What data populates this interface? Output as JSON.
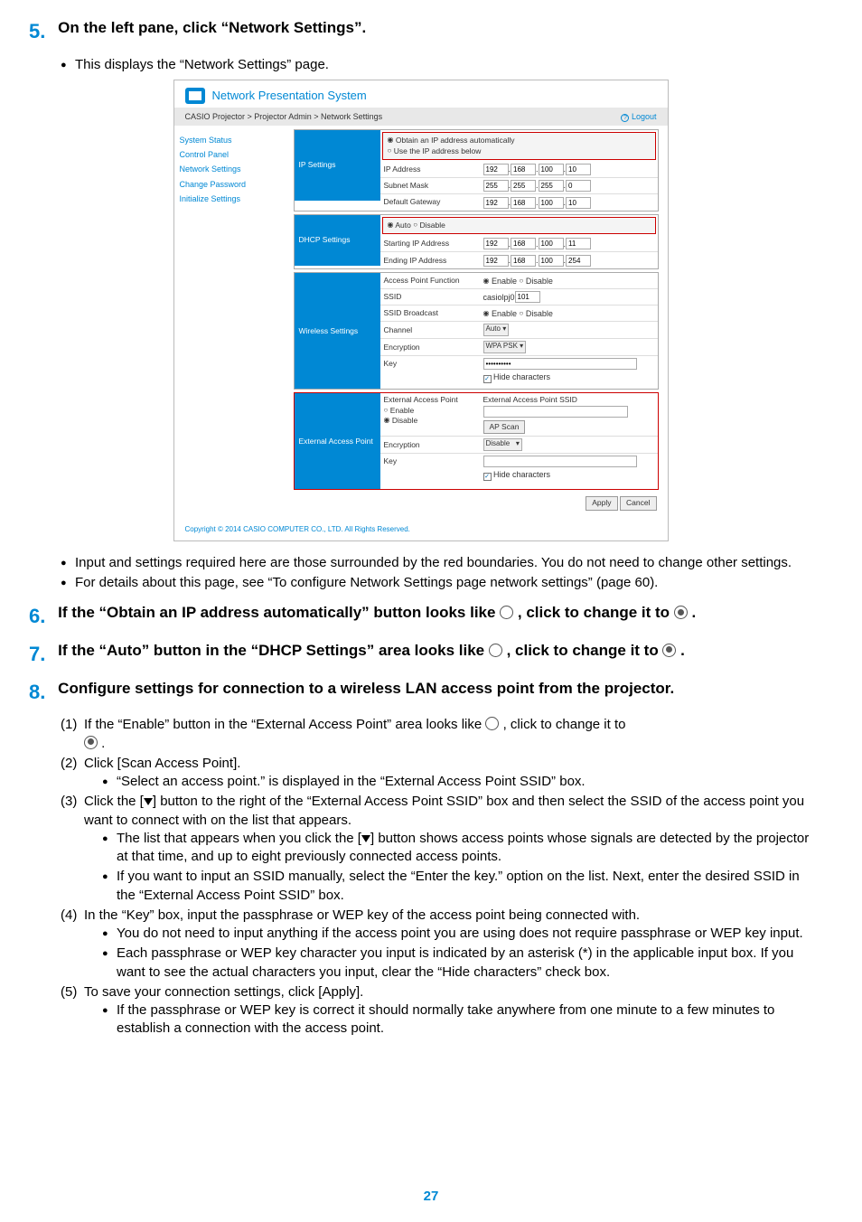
{
  "step5": {
    "num": "5.",
    "heading": "On the left pane, click “Network Settings”.",
    "bullet1": "This displays the “Network Settings” page."
  },
  "screenshot": {
    "window_title": "Network Presentation System",
    "breadcrumb": "CASIO Projector > Projector Admin > Network Settings",
    "logout": "Logout",
    "nav": [
      "System Status",
      "Control Panel",
      "Network Settings",
      "Change Password",
      "Initialize Settings"
    ],
    "ip_settings": {
      "title": "IP Settings",
      "opt_auto": "Obtain an IP address automatically",
      "opt_manual": "Use the IP address below",
      "ip_label": "IP Address",
      "ip": [
        "192",
        "168",
        "100",
        "10"
      ],
      "mask_label": "Subnet Mask",
      "mask": [
        "255",
        "255",
        "255",
        "0"
      ],
      "gw_label": "Default Gateway",
      "gw": [
        "192",
        "168",
        "100",
        "10"
      ]
    },
    "dhcp_settings": {
      "title": "DHCP Settings",
      "auto": "Auto",
      "disable": "Disable",
      "start_label": "Starting IP Address",
      "start": [
        "192",
        "168",
        "100",
        "11"
      ],
      "end_label": "Ending IP Address",
      "end": [
        "192",
        "168",
        "100",
        "254"
      ]
    },
    "wireless": {
      "title": "Wireless Settings",
      "apf_label": "Access Point Function",
      "enable": "Enable",
      "disable": "Disable",
      "ssid_label": "SSID",
      "ssid_prefix": "casiolpj0",
      "ssid_suffix": "101",
      "ssidbr_label": "SSID Broadcast",
      "ch_label": "Channel",
      "ch": "Auto",
      "enc_label": "Encryption",
      "enc": "WPA PSK",
      "key_label": "Key",
      "key": "••••••••••",
      "hide": "Hide characters"
    },
    "ext_ap": {
      "title": "External Access Point",
      "heading": "External Access Point",
      "enable": "Enable",
      "disable": "Disable",
      "ssid_label": "External Access Point SSID",
      "scan_btn": "AP Scan",
      "enc_label": "Encryption",
      "enc": "Disable",
      "key_label": "Key",
      "hide": "Hide characters"
    },
    "apply": "Apply",
    "cancel": "Cancel",
    "copyright": "Copyright © 2014 CASIO COMPUTER CO., LTD. All Rights Reserved."
  },
  "post5": {
    "b1": "Input and settings required here are those surrounded by the red boundaries. You do not need to change other settings.",
    "b2": "For details about this page, see “To configure Network Settings page network settings” (page 60)."
  },
  "step6": {
    "num": "6.",
    "part1": "If the “Obtain an IP address automatically” button looks like ",
    "part2": " , click to change it to ",
    "part3": " ."
  },
  "step7": {
    "num": "7.",
    "part1": "If the “Auto” button in the “DHCP Settings” area looks like ",
    "part2": " , click to change it to ",
    "part3": " ."
  },
  "step8": {
    "num": "8.",
    "heading": "Configure settings for connection to a wireless LAN access point from the projector.",
    "n1": {
      "num": "(1)",
      "p1": "If the “Enable” button in the “External Access Point” area looks like ",
      "p2": " , click to change it to ",
      "p3": " ."
    },
    "n2": {
      "num": "(2)",
      "text": "Click [Scan Access Point].",
      "b1": "“Select an access point.” is displayed in the “External Access Point SSID” box."
    },
    "n3": {
      "num": "(3)",
      "p1": "Click the [",
      "p2": "] button to the right of the “External Access Point SSID” box and then select the SSID of the access point you want to connect with on the list that appears.",
      "b1p1": "The list that appears when you click the [",
      "b1p2": "] button shows access points whose signals are detected by the projector at that time, and up to eight previously connected access points.",
      "b2": "If you want to input an SSID manually, select the “Enter the key.” option on the list. Next, enter the desired SSID in the “External Access Point SSID” box."
    },
    "n4": {
      "num": "(4)",
      "text": "In the “Key” box, input the passphrase or WEP key of the access point being connected with.",
      "b1": "You do not need to input anything if the access point you are using does not require passphrase or WEP key input.",
      "b2": "Each passphrase or WEP key character you input is indicated by an asterisk (*) in the applicable input box. If you want to see the actual characters you input, clear the “Hide characters” check box."
    },
    "n5": {
      "num": "(5)",
      "text": "To save your connection settings, click [Apply].",
      "b1": "If the passphrase or WEP key is correct it should normally take anywhere from one minute to a few minutes to establish a connection with the access point."
    }
  },
  "pagenum": "27"
}
